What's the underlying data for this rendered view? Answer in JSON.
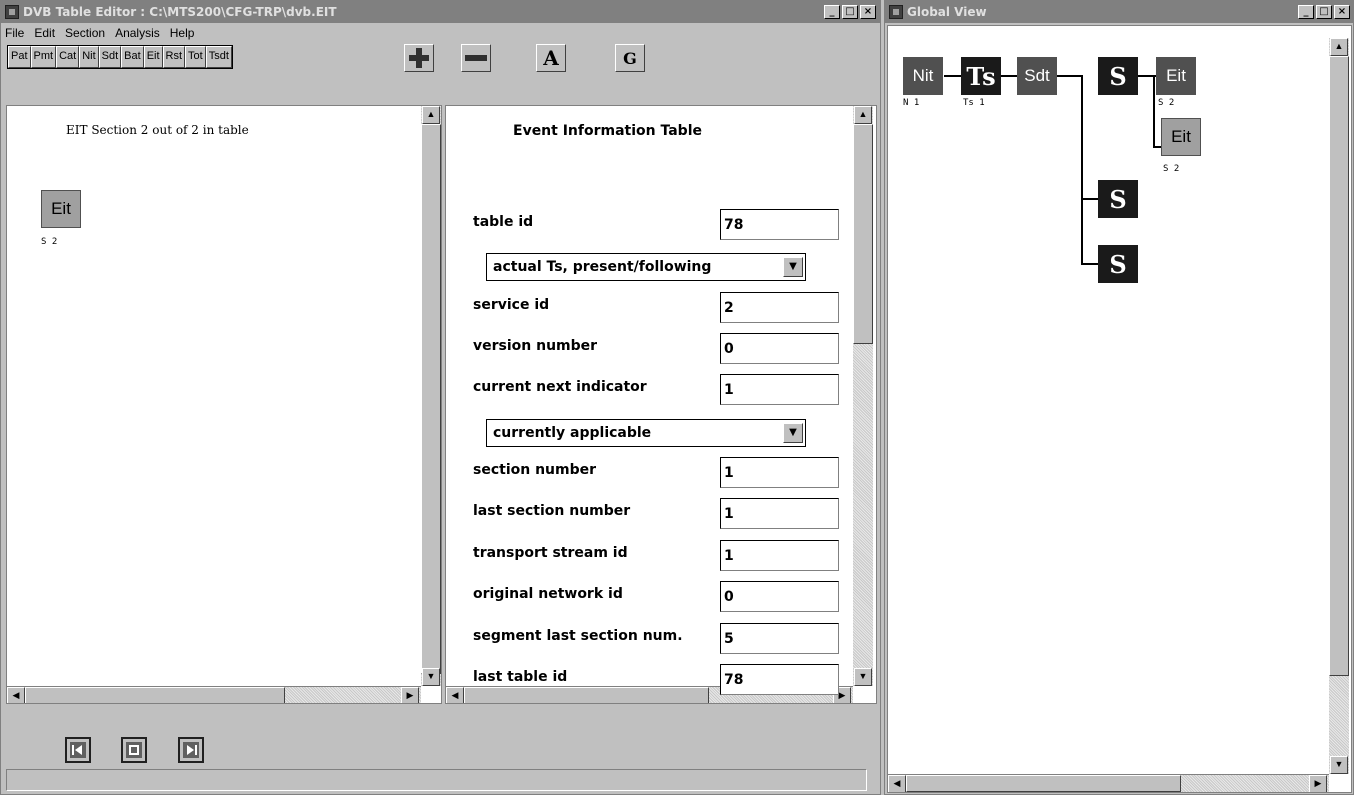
{
  "editor": {
    "title": "DVB Table Editor : C:\\MTS200\\CFG-TRP\\dvb.EIT",
    "menus": [
      "File",
      "Edit",
      "Section",
      "Analysis",
      "Help"
    ],
    "table_buttons": [
      "Pat",
      "Pmt",
      "Cat",
      "Nit",
      "Sdt",
      "Bat",
      "Eit",
      "Rst",
      "Tot",
      "Tsdt"
    ],
    "tools": {
      "add": "+",
      "remove": "−",
      "a": "A",
      "g": "G"
    },
    "section_caption": "EIT Section 2 out of 2 in table",
    "section_node": {
      "label": "Eit",
      "sub": "S 2"
    },
    "form": {
      "heading": "Event Information Table",
      "table_id_label": "table id",
      "table_id": "78",
      "table_type": "actual Ts, present/following",
      "service_id_label": "service id",
      "service_id": "2",
      "version_number_label": "version number",
      "version_number": "0",
      "current_next_indicator_label": "current next indicator",
      "current_next_indicator": "1",
      "applicability": "currently applicable",
      "section_number_label": "section number",
      "section_number": "1",
      "last_section_number_label": "last section number",
      "last_section_number": "1",
      "transport_stream_id_label": "transport stream id",
      "transport_stream_id": "1",
      "original_network_id_label": "original network id",
      "original_network_id": "0",
      "segment_last_section_label": "segment last section num.",
      "segment_last_section": "5",
      "last_table_id_label": "last table id",
      "last_table_id": "78"
    }
  },
  "global_view": {
    "title": "Global View",
    "nodes": {
      "nit": "Nit",
      "nit_sub": "N 1",
      "ts": "Ts",
      "ts_sub": "Ts 1",
      "sdt": "Sdt",
      "s": "S",
      "eit": "Eit",
      "eit_sub": "S 2"
    }
  },
  "window_controls": {
    "minimize": "_",
    "maximize": "□",
    "close": "×"
  },
  "icons": [
    "window-menu-icon",
    "first-record-icon",
    "edit-record-icon",
    "last-record-icon"
  ]
}
